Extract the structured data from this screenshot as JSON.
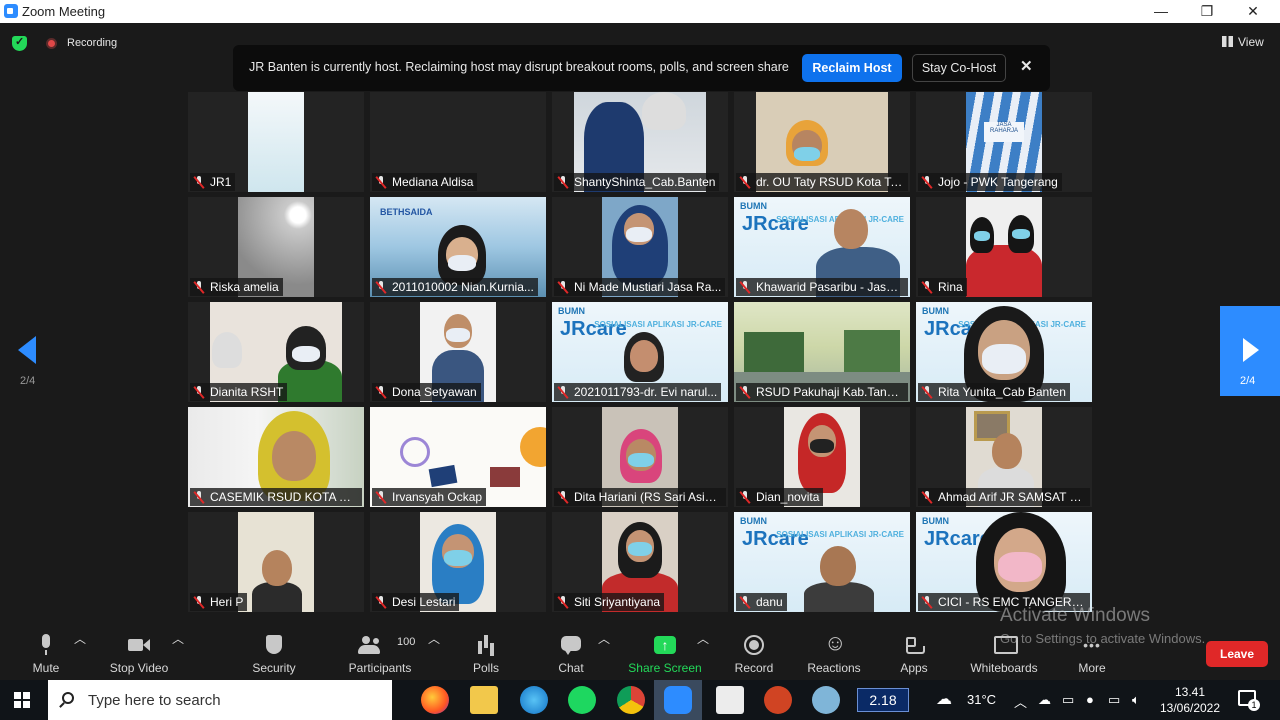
{
  "window": {
    "title": "Zoom Meeting",
    "minimize": "—",
    "restore": "❐",
    "close": "✕"
  },
  "status": {
    "recording": "Recording",
    "view": "View"
  },
  "host_banner": {
    "message": "JR Banten is currently host. Reclaiming host may disrupt breakout rooms, polls, and screen share",
    "reclaim": "Reclaim Host",
    "stay": "Stay Co-Host",
    "close": "✕"
  },
  "pager": {
    "left": "2/4",
    "right": "2/4"
  },
  "participants": [
    "JR1",
    "Mediana Aldisa",
    "ShantyShinta_Cab.Banten",
    "dr. OU Taty RSUD Kota Ta...",
    "Jojo - PWK Tangerang",
    "Riska amelia",
    "2011010002 Nian.Kurnia...",
    "Ni Made Mustiari Jasa Ra...",
    "Khawarid Pasaribu - Jasa ...",
    "Rina",
    "Dianita RSHT",
    "Dona Setyawan",
    "2021011793-dr. Evi narul...",
    "RSUD Pakuhaji Kab.Tange...",
    "Rita Yunita_Cab Banten",
    "CASEMIK RSUD KOTA TNG",
    "Irvansyah Ockap",
    "Dita Hariani (RS Sari Asih ...",
    "Dian_novita",
    "Ahmad Arif JR SAMSAT C...",
    "Heri P",
    "Desi Lestari",
    "Siti Sriyantiyana",
    "danu",
    "CICI - RS EMC TANGERA..."
  ],
  "tile_text": {
    "bumn": "BUMN",
    "jrcare": "JRcare",
    "sosialisasi": "SOSIALISASI APLIKASI JR-CARE",
    "bethsaida": "BETHSAIDA",
    "jasa_raharja": "JASA RAHARJA"
  },
  "toolbar": {
    "mute": "Mute",
    "stop_video": "Stop Video",
    "security": "Security",
    "participants": "Participants",
    "participant_count": "100",
    "polls": "Polls",
    "chat": "Chat",
    "share_screen": "Share Screen",
    "record": "Record",
    "reactions": "Reactions",
    "apps": "Apps",
    "whiteboards": "Whiteboards",
    "more": "More",
    "leave": "Leave"
  },
  "watermark": {
    "title": "Activate Windows",
    "subtitle": "Go to Settings to activate Windows."
  },
  "taskbar": {
    "search_placeholder": "Type here to search",
    "cpu": "2.18",
    "temperature": "31°C",
    "time": "13.41",
    "date": "13/06/2022",
    "notifications": "1"
  },
  "colors": {
    "accent": "#2d8cff",
    "share_green": "#23d959",
    "leave_red": "#e02828",
    "reclaim_blue": "#0e72ed"
  }
}
